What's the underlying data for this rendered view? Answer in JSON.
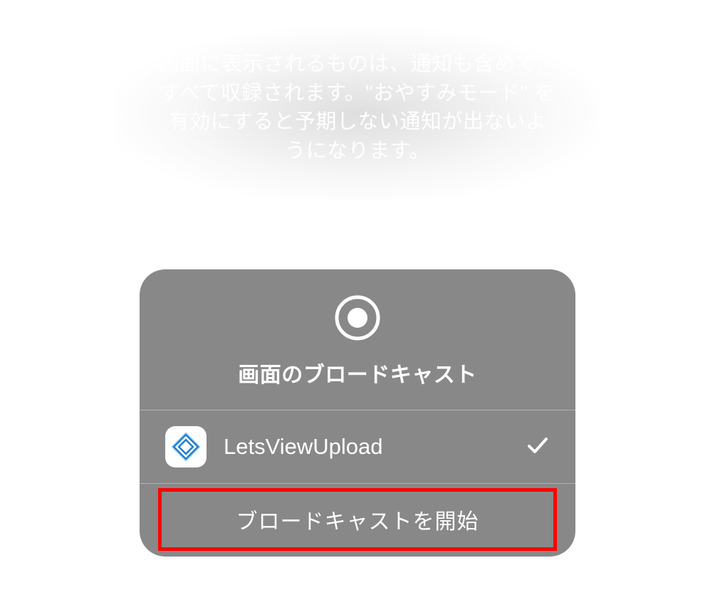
{
  "info": {
    "text": "画面に表示されるものは、通知も含めて、すべて収録されます。\"おやすみモード\" を有効にすると予期しない通知が出ないようになります。"
  },
  "panel": {
    "title": "画面のブロードキャスト",
    "app": {
      "name": "LetsViewUpload",
      "selected": true
    },
    "start_button": "ブロードキャストを開始"
  }
}
